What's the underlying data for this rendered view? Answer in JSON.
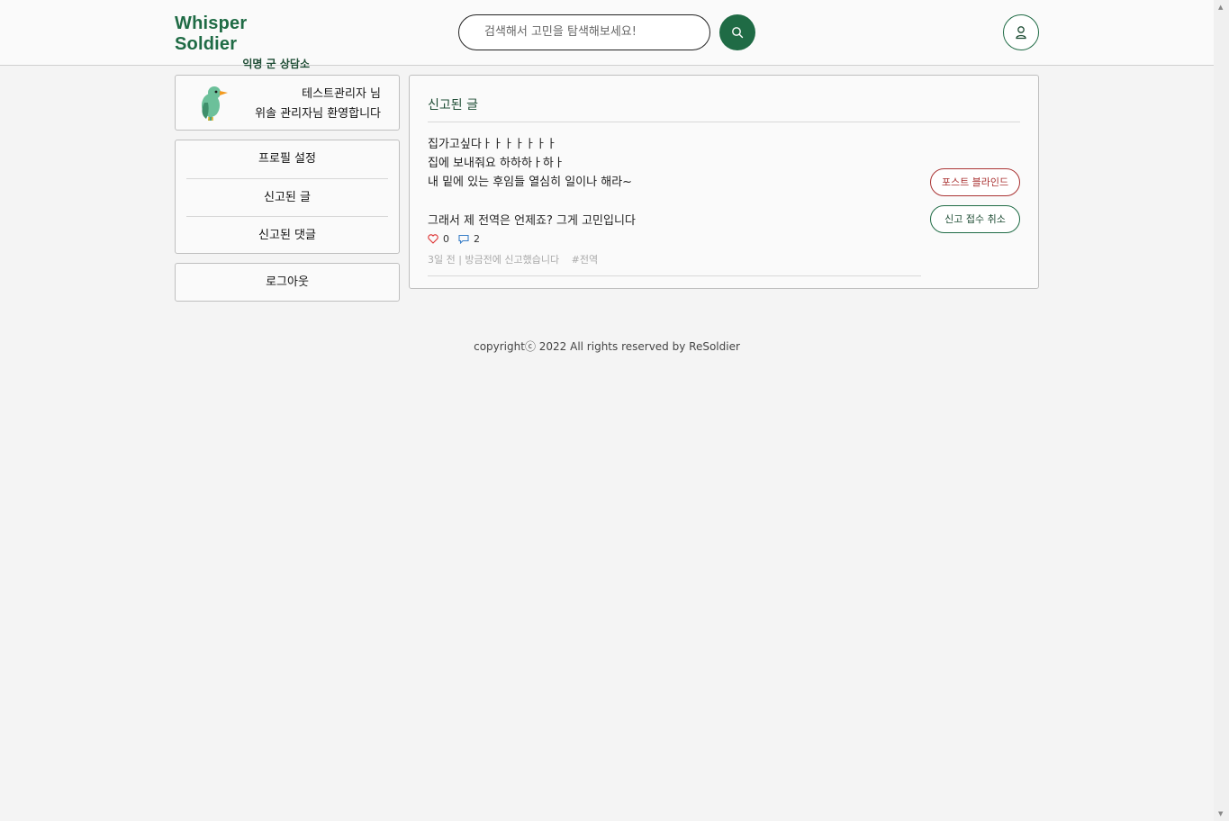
{
  "header": {
    "logo_title": "Whisper Soldier",
    "logo_subtitle": "익명 군 상담소",
    "search_placeholder": "검색해서 고민을 탐색해보세요!",
    "search_icon": "search-icon",
    "user_icon": "user-icon"
  },
  "profile": {
    "name": "테스트관리자 님",
    "welcome": "위솔 관리자님 환영합니다",
    "avatar_icon": "bird-icon"
  },
  "sidebar": {
    "items": [
      {
        "label": "프로필 설정"
      },
      {
        "label": "신고된 글"
      },
      {
        "label": "신고된 댓글"
      }
    ],
    "logout_label": "로그아웃"
  },
  "main": {
    "title": "신고된 글",
    "post": {
      "body_lines": [
        "집가고싶다ㅏㅏㅏㅏㅏㅏㅏ",
        "집에 보내줘요 하하하ㅏ하ㅏ",
        "내 밑에 있는 후임들 열심히 일이나 해라~"
      ],
      "title": "그래서 제 전역은 언제죠? 그게 고민입니다",
      "likes": "0",
      "comments": "2",
      "meta": "3일 전 | 방금전에 신고했습니다",
      "tag": "#전역",
      "blind_button": "포스트 블라인드",
      "cancel_button": "신고 접수 취소"
    }
  },
  "footer": {
    "copyright": "copyrightⓒ 2022 All rights reserved by ReSoldier"
  },
  "colors": {
    "brand_green": "#1f6b45",
    "danger_red": "#aa3333",
    "background": "#f4f4f4"
  }
}
